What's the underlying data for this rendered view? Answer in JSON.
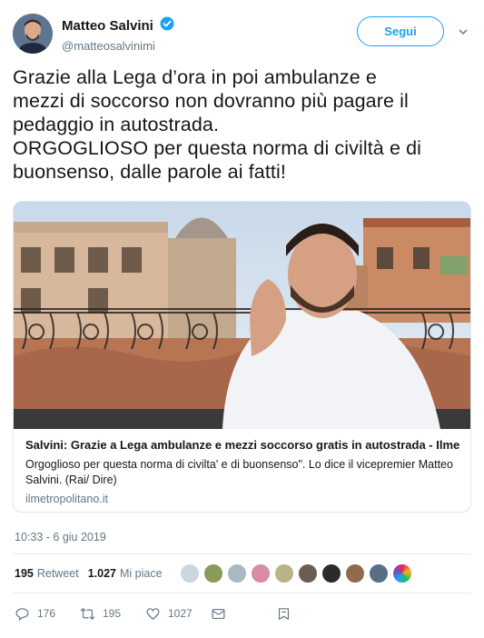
{
  "user": {
    "display_name": "Matteo Salvini",
    "handle": "@matteosalvinimi",
    "verified": true
  },
  "follow_label": "Segui",
  "tweet_text": "Grazie alla Lega d’ora in poi ambulanze e\nmezzi di soccorso non dovranno più pagare il\npedaggio in autostrada.\nORGOGLIOSO per questa norma di civiltà e di\nbuonsenso, dalle parole ai fatti!",
  "card": {
    "title": "Salvini: Grazie a Lega ambulanze e mezzi soccorso gratis in autostrada - Ilme...",
    "description": "Orgoglioso per questa norma di civilta' e di buonsenso\". Lo dice il vicepremier Matteo Salvini. (Rai/ Dire)",
    "domain": "ilmetropolitano.it"
  },
  "timestamp": "10:33 - 6 giu 2019",
  "stats": {
    "retweets": "195",
    "retweets_label": "Retweet",
    "likes": "1.027",
    "likes_label": "Mi piace"
  },
  "actions": {
    "reply_count": "176",
    "retweet_count": "195",
    "like_count": "1027"
  },
  "colors": {
    "accent": "#1da1f2",
    "text": "#14171a",
    "secondary": "#657786",
    "border": "#e1e8ed"
  },
  "icons": [
    "verified-icon",
    "chevron-down-icon",
    "reply-icon",
    "retweet-icon",
    "heart-icon",
    "message-icon",
    "share-icon"
  ]
}
